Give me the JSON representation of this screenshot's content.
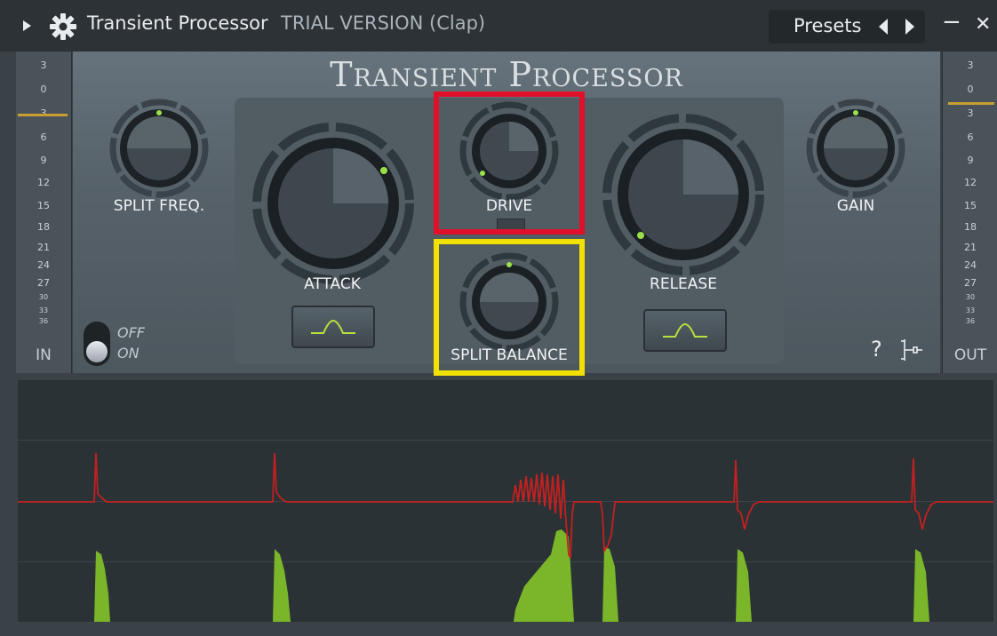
{
  "window": {
    "title": "Transient Processor",
    "subtitle": "TRIAL VERSION (Clap)",
    "presets_label": "Presets",
    "minimize_glyph": "−",
    "close_glyph": "✕"
  },
  "panel": {
    "title": "Transient Processor"
  },
  "knobs": {
    "split_freq": "SPLIT FREQ.",
    "attack": "ATTACK",
    "drive": "DRIVE",
    "split_balance": "SPLIT BALANCE",
    "release": "RELEASE",
    "gain": "GAIN"
  },
  "toggle": {
    "off": "OFF",
    "on": "ON"
  },
  "help_glyph": "?",
  "meters": {
    "in_label": "IN",
    "out_label": "OUT",
    "scale": [
      "3",
      "0",
      "3",
      "6",
      "9",
      "12",
      "15",
      "18",
      "21",
      "24",
      "27",
      "30",
      "33",
      "36"
    ]
  },
  "highlights": {
    "drive_color": "#e0102a",
    "split_balance_color": "#f2e000"
  },
  "colors": {
    "led_green": "#9be04a",
    "waveform_green": "#7ab52a",
    "envelope_red": "#c42020"
  }
}
